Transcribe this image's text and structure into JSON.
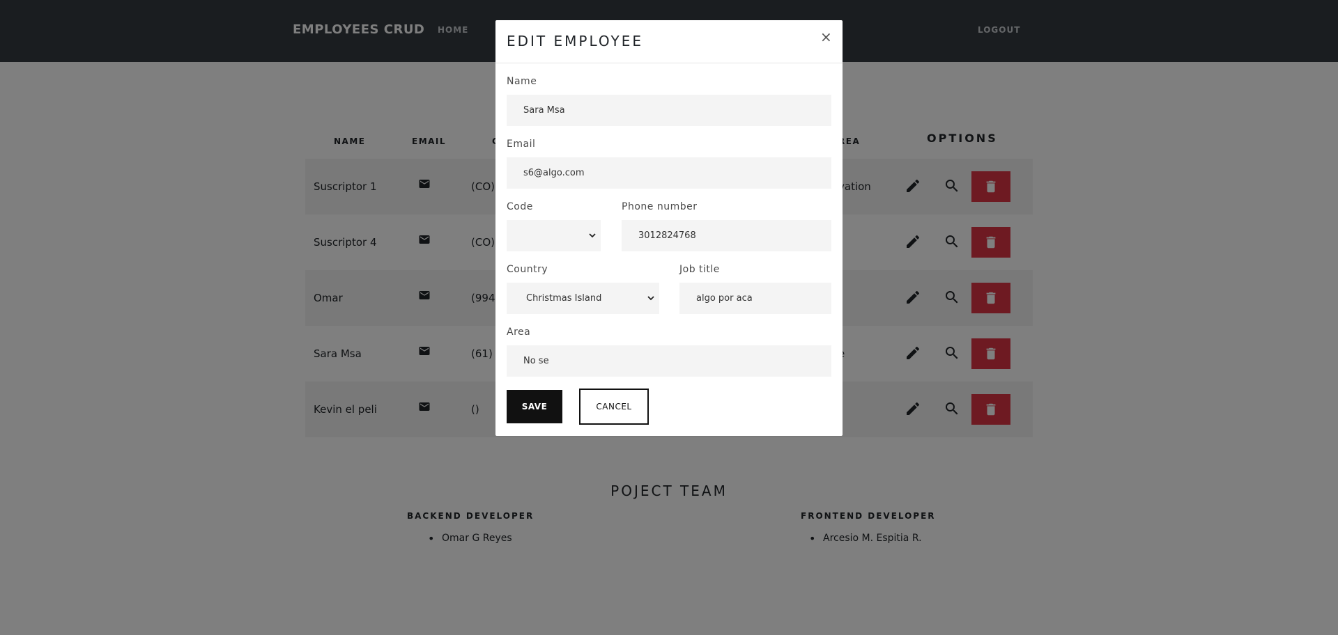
{
  "navbar": {
    "brand": "EMPLOYEES CRUD",
    "home": "HOME",
    "logout": "LOGOUT"
  },
  "table": {
    "headers": {
      "name": "NAME",
      "email": "EMAIL",
      "code": "C",
      "area": "REA",
      "options": "OPTIONS"
    },
    "rows": [
      {
        "name": "Suscriptor 1",
        "code": "(CO)",
        "area": "vation"
      },
      {
        "name": "Suscriptor 4",
        "code": "(CO)",
        "area": ""
      },
      {
        "name": "Omar",
        "code": "(994",
        "area": ""
      },
      {
        "name": "Sara Msa",
        "code": "(61)",
        "area": "e"
      },
      {
        "name": "Kevin el peli",
        "code": "()",
        "area": ""
      }
    ]
  },
  "team": {
    "title": "POJECT TEAM",
    "backend_role": "BACKEND DEVELOPER",
    "backend_member": "Omar G Reyes",
    "frontend_role": "FRONTEND DEVELOPER",
    "frontend_member": "Arcesio M. Espitia R."
  },
  "modal": {
    "title": "EDIT EMPLOYEE",
    "close": "×",
    "fields": {
      "name": {
        "label": "Name",
        "value": "Sara Msa"
      },
      "email": {
        "label": "Email",
        "value": "s6@algo.com"
      },
      "code": {
        "label": "Code",
        "value": ""
      },
      "phone": {
        "label": "Phone number",
        "value": "3012824768"
      },
      "country": {
        "label": "Country",
        "value": "Christmas Island"
      },
      "job": {
        "label": "Job title",
        "value": "algo por aca"
      },
      "area": {
        "label": "Area",
        "value": "No se"
      }
    },
    "save": "SAVE",
    "cancel": "CANCEL"
  },
  "colors": {
    "navbar": "#343a40",
    "danger": "#dc3545",
    "stripe": "#f2f2f2",
    "primary_button": "#111111"
  },
  "icons": {
    "email": "envelope-icon",
    "edit": "pencil-icon",
    "view": "magnifier-icon",
    "delete": "trash-icon",
    "select": "chevron-down-icon"
  }
}
